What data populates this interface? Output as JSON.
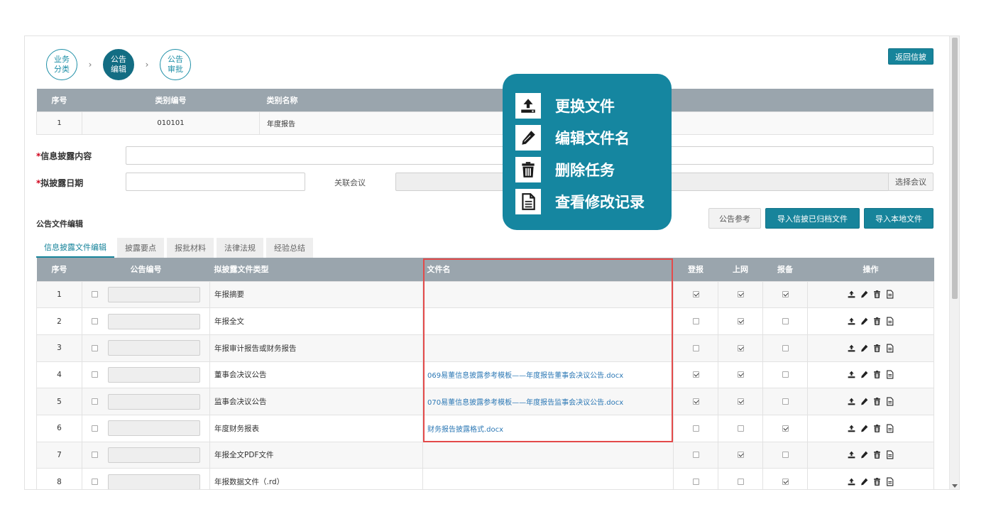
{
  "steps": [
    {
      "line1": "业务",
      "line2": "分类"
    },
    {
      "line1": "公告",
      "line2": "编辑"
    },
    {
      "line1": "公告",
      "line2": "审批"
    }
  ],
  "return_button": "返回信披",
  "category_table": {
    "headers": [
      "序号",
      "类别编号",
      "类别名称"
    ],
    "row": {
      "index": "1",
      "code": "010101",
      "name": "年度报告"
    }
  },
  "form": {
    "disclosure_content_label": "*信息披露内容",
    "planned_date_label": "*拟披露日期",
    "related_meeting_label": "关联会议",
    "select_meeting_button": "选择会议"
  },
  "section_title": "公告文件编辑",
  "action_buttons": {
    "reference": "公告参考",
    "import_archived": "导入信披已归档文件",
    "import_local": "导入本地文件"
  },
  "tabs": [
    "信息披露文件编辑",
    "披露要点",
    "报批材料",
    "法律法规",
    "经验总结"
  ],
  "file_table": {
    "headers": [
      "序号",
      "公告编号",
      "拟披露文件类型",
      "文件名",
      "登报",
      "上网",
      "报备",
      "操作"
    ],
    "rows": [
      {
        "index": "1",
        "type": "年报摘要",
        "file": "",
        "paper": true,
        "web": true,
        "filing": true
      },
      {
        "index": "2",
        "type": "年报全文",
        "file": "",
        "paper": false,
        "web": true,
        "filing": false
      },
      {
        "index": "3",
        "type": "年报审计报告或财务报告",
        "file": "",
        "paper": false,
        "web": true,
        "filing": false
      },
      {
        "index": "4",
        "type": "董事会决议公告",
        "file": "069易董信息披露参考模板——年度报告董事会决议公告.docx",
        "paper": true,
        "web": true,
        "filing": false
      },
      {
        "index": "5",
        "type": "监事会决议公告",
        "file": "070易董信息披露参考模板——年度报告监事会决议公告.docx",
        "paper": true,
        "web": true,
        "filing": false
      },
      {
        "index": "6",
        "type": "年度财务报表",
        "file": "财务报告披露格式.docx",
        "paper": false,
        "web": false,
        "filing": true
      },
      {
        "index": "7",
        "type": "年报全文PDF文件",
        "file": "",
        "paper": false,
        "web": true,
        "filing": false
      },
      {
        "index": "8",
        "type": "年报数据文件（.rd）",
        "file": "",
        "paper": false,
        "web": false,
        "filing": true
      }
    ]
  },
  "callout": {
    "items": [
      {
        "icon": "upload-icon",
        "label": "更换文件"
      },
      {
        "icon": "pencil-icon",
        "label": "编辑文件名"
      },
      {
        "icon": "trash-icon",
        "label": "删除任务"
      },
      {
        "icon": "document-icon",
        "label": "查看修改记录"
      }
    ]
  },
  "colors": {
    "accent": "#17849b",
    "header_gray": "#9aa5ad",
    "callout": "#1586a0",
    "highlight": "#e34a4a"
  }
}
